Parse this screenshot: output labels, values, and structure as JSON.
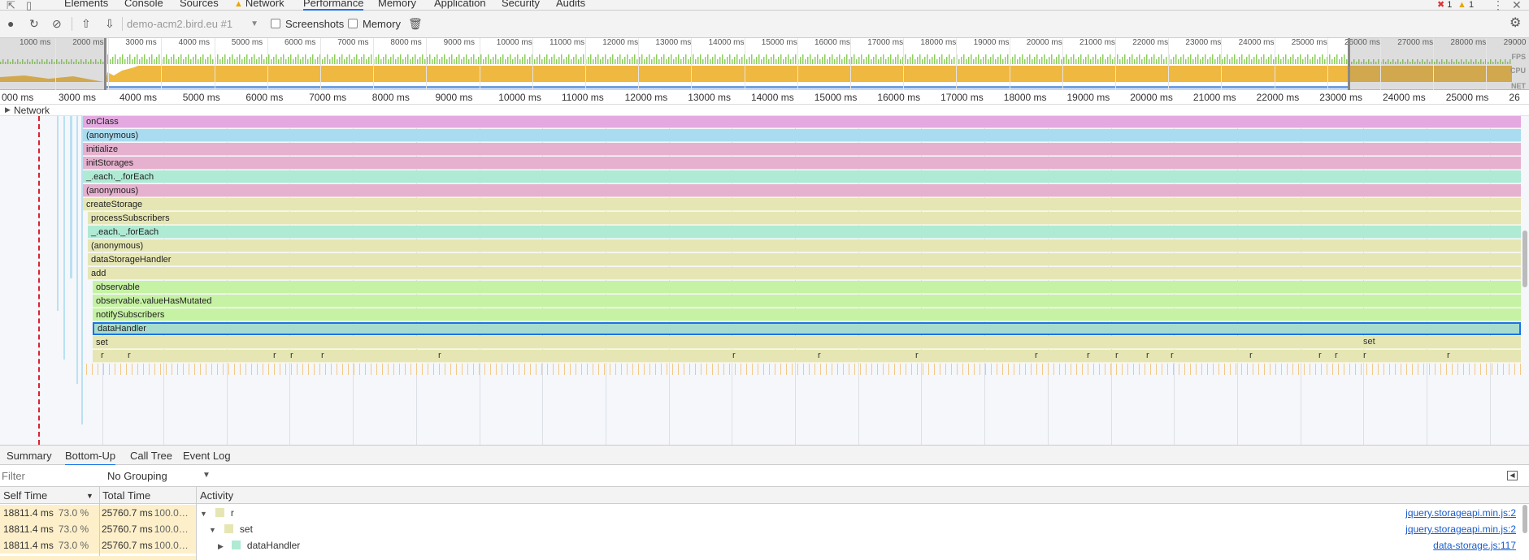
{
  "devtools_tabs": [
    {
      "label": "Elements"
    },
    {
      "label": "Console"
    },
    {
      "label": "Sources"
    },
    {
      "label": "Network",
      "warning": true
    },
    {
      "label": "Performance",
      "active": true
    },
    {
      "label": "Memory"
    },
    {
      "label": "Application"
    },
    {
      "label": "Security"
    },
    {
      "label": "Audits"
    }
  ],
  "status": {
    "errors": "1",
    "warnings": "1"
  },
  "toolbar": {
    "profile": "demo-acm2.bird.eu #1",
    "screenshots_label": "Screenshots",
    "memory_label": "Memory",
    "screenshots_checked": false,
    "memory_checked": false
  },
  "overview": {
    "ticks": [
      "1000 ms",
      "2000 ms",
      "3000 ms",
      "4000 ms",
      "5000 ms",
      "6000 ms",
      "7000 ms",
      "8000 ms",
      "9000 ms",
      "10000 ms",
      "11000 ms",
      "12000 ms",
      "13000 ms",
      "14000 ms",
      "15000 ms",
      "16000 ms",
      "17000 ms",
      "18000 ms",
      "19000 ms",
      "20000 ms",
      "21000 ms",
      "22000 ms",
      "23000 ms",
      "24000 ms",
      "25000 ms",
      "26000 ms",
      "27000 ms",
      "28000 ms",
      "29000"
    ],
    "lanes": {
      "fps": "FPS",
      "cpu": "CPU",
      "net": "NET"
    },
    "colors": {
      "fps": "#8ccf5c",
      "cpu": "#efb840",
      "net": "#6fa0e0"
    }
  },
  "ruler_ticks": [
    "000 ms",
    "3000 ms",
    "4000 ms",
    "5000 ms",
    "6000 ms",
    "7000 ms",
    "8000 ms",
    "9000 ms",
    "10000 ms",
    "11000 ms",
    "12000 ms",
    "13000 ms",
    "14000 ms",
    "15000 ms",
    "16000 ms",
    "17000 ms",
    "18000 ms",
    "19000 ms",
    "20000 ms",
    "21000 ms",
    "22000 ms",
    "23000 ms",
    "24000 ms",
    "25000 ms",
    "26"
  ],
  "flame": {
    "network_label": "Network",
    "frames": [
      {
        "name": "onClass",
        "color": "#e3a9e0",
        "depth": 0,
        "indent": 0
      },
      {
        "name": "(anonymous)",
        "color": "#a9dcf0",
        "depth": 1,
        "indent": 0
      },
      {
        "name": "initialize",
        "color": "#e6b1cf",
        "depth": 2,
        "indent": 0
      },
      {
        "name": "initStorages",
        "color": "#e6b1cf",
        "depth": 3,
        "indent": 0
      },
      {
        "name": "_.each._.forEach",
        "color": "#aeead4",
        "depth": 4,
        "indent": 0
      },
      {
        "name": "(anonymous)",
        "color": "#e6b1cf",
        "depth": 5,
        "indent": 0
      },
      {
        "name": "createStorage",
        "color": "#e6e6b4",
        "depth": 6,
        "indent": 0
      },
      {
        "name": "processSubscribers",
        "color": "#e6e6b4",
        "depth": 7,
        "indent": 1
      },
      {
        "name": "_.each._.forEach",
        "color": "#aeead4",
        "depth": 8,
        "indent": 1
      },
      {
        "name": "(anonymous)",
        "color": "#e6e6b4",
        "depth": 9,
        "indent": 1
      },
      {
        "name": "dataStorageHandler",
        "color": "#e6e6b4",
        "depth": 10,
        "indent": 1
      },
      {
        "name": "add",
        "color": "#e6e6b4",
        "depth": 11,
        "indent": 1
      },
      {
        "name": "observable",
        "color": "#c6f2a4",
        "depth": 12,
        "indent": 2
      },
      {
        "name": "observable.valueHasMutated",
        "color": "#c6f2a4",
        "depth": 13,
        "indent": 2
      },
      {
        "name": "notifySubscribers",
        "color": "#c6f2a4",
        "depth": 14,
        "indent": 2
      },
      {
        "name": "dataHandler",
        "color": "#a6dccf",
        "depth": 15,
        "indent": 2,
        "selected": true
      },
      {
        "name": "set",
        "color": "#e6e6b4",
        "depth": 16,
        "indent": 2
      }
    ],
    "set_label_right": "set",
    "r_label": "r"
  },
  "bottom_tabs": [
    {
      "label": "Summary"
    },
    {
      "label": "Bottom-Up",
      "active": true
    },
    {
      "label": "Call Tree"
    },
    {
      "label": "Event Log"
    }
  ],
  "filter": {
    "placeholder": "Filter",
    "grouping": "No Grouping"
  },
  "table": {
    "headers": {
      "self": "Self Time",
      "total": "Total Time",
      "activity": "Activity"
    },
    "rows": [
      {
        "self": "18811.4 ms",
        "self_pct": "73.0 %",
        "total": "25760.7 ms",
        "total_pct": "100.0…",
        "activity": "r",
        "color": "#e6e6b4",
        "level": 0,
        "expanded": true,
        "link": "jquery.storageapi.min.js:2"
      },
      {
        "self": "18811.4 ms",
        "self_pct": "73.0 %",
        "total": "25760.7 ms",
        "total_pct": "100.0…",
        "activity": "set",
        "color": "#e6e6b4",
        "level": 1,
        "expanded": true,
        "link": "jquery.storageapi.min.js:2"
      },
      {
        "self": "18811.4 ms",
        "self_pct": "73.0 %",
        "total": "25760.7 ms",
        "total_pct": "100.0…",
        "activity": "dataHandler",
        "color": "#aeead4",
        "level": 2,
        "expanded": false,
        "link": "data-storage.js:117"
      }
    ]
  }
}
